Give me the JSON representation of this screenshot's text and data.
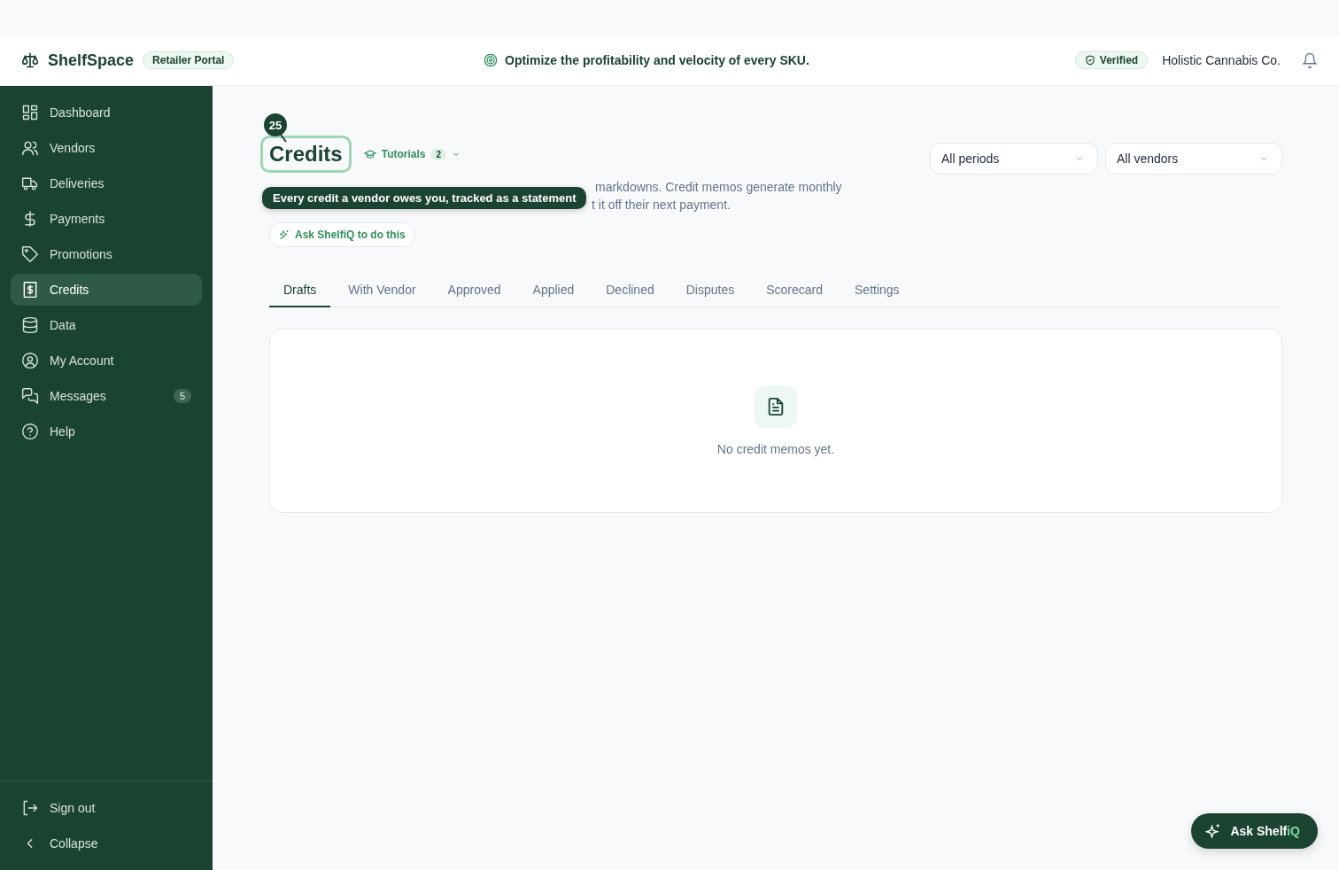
{
  "header": {
    "brand": "ShelfSpace",
    "portal_badge": "Retailer Portal",
    "tagline": "Optimize the profitability and velocity of every SKU.",
    "verified_badge": "Verified",
    "company": "Holistic Cannabis Co."
  },
  "sidebar": {
    "items": [
      {
        "label": "Dashboard",
        "selected": false
      },
      {
        "label": "Vendors",
        "selected": false
      },
      {
        "label": "Deliveries",
        "selected": false
      },
      {
        "label": "Payments",
        "selected": false
      },
      {
        "label": "Promotions",
        "selected": false
      },
      {
        "label": "Credits",
        "selected": true
      },
      {
        "label": "Data",
        "selected": false
      },
      {
        "label": "My Account",
        "selected": false
      },
      {
        "label": "Messages",
        "selected": false,
        "badge": "5"
      },
      {
        "label": "Help",
        "selected": false
      }
    ],
    "footer": [
      {
        "label": "Sign out"
      },
      {
        "label": "Collapse"
      }
    ]
  },
  "page": {
    "step_badge": "25",
    "title": "Credits",
    "tutorials": {
      "label": "Tutorials",
      "count": "2"
    },
    "description_line_1": "markdowns. Credit memos generate monthly",
    "description_line_2": "t it off their next payment.",
    "tooltip": "Every credit a vendor owes you, tracked as a statement",
    "ask_button": "Ask ShelfiQ to do this",
    "filters": [
      {
        "value": "All periods"
      },
      {
        "value": "All vendors"
      }
    ],
    "tabs": [
      {
        "label": "Drafts",
        "selected": true
      },
      {
        "label": "With Vendor",
        "selected": false
      },
      {
        "label": "Approved",
        "selected": false
      },
      {
        "label": "Applied",
        "selected": false
      },
      {
        "label": "Declined",
        "selected": false
      },
      {
        "label": "Disputes",
        "selected": false
      },
      {
        "label": "Scorecard",
        "selected": false
      },
      {
        "label": "Settings",
        "selected": false
      }
    ],
    "empty_state": "No credit memos yet."
  },
  "assistant_button": {
    "label": "Ask Shelf",
    "accent": "iQ"
  }
}
